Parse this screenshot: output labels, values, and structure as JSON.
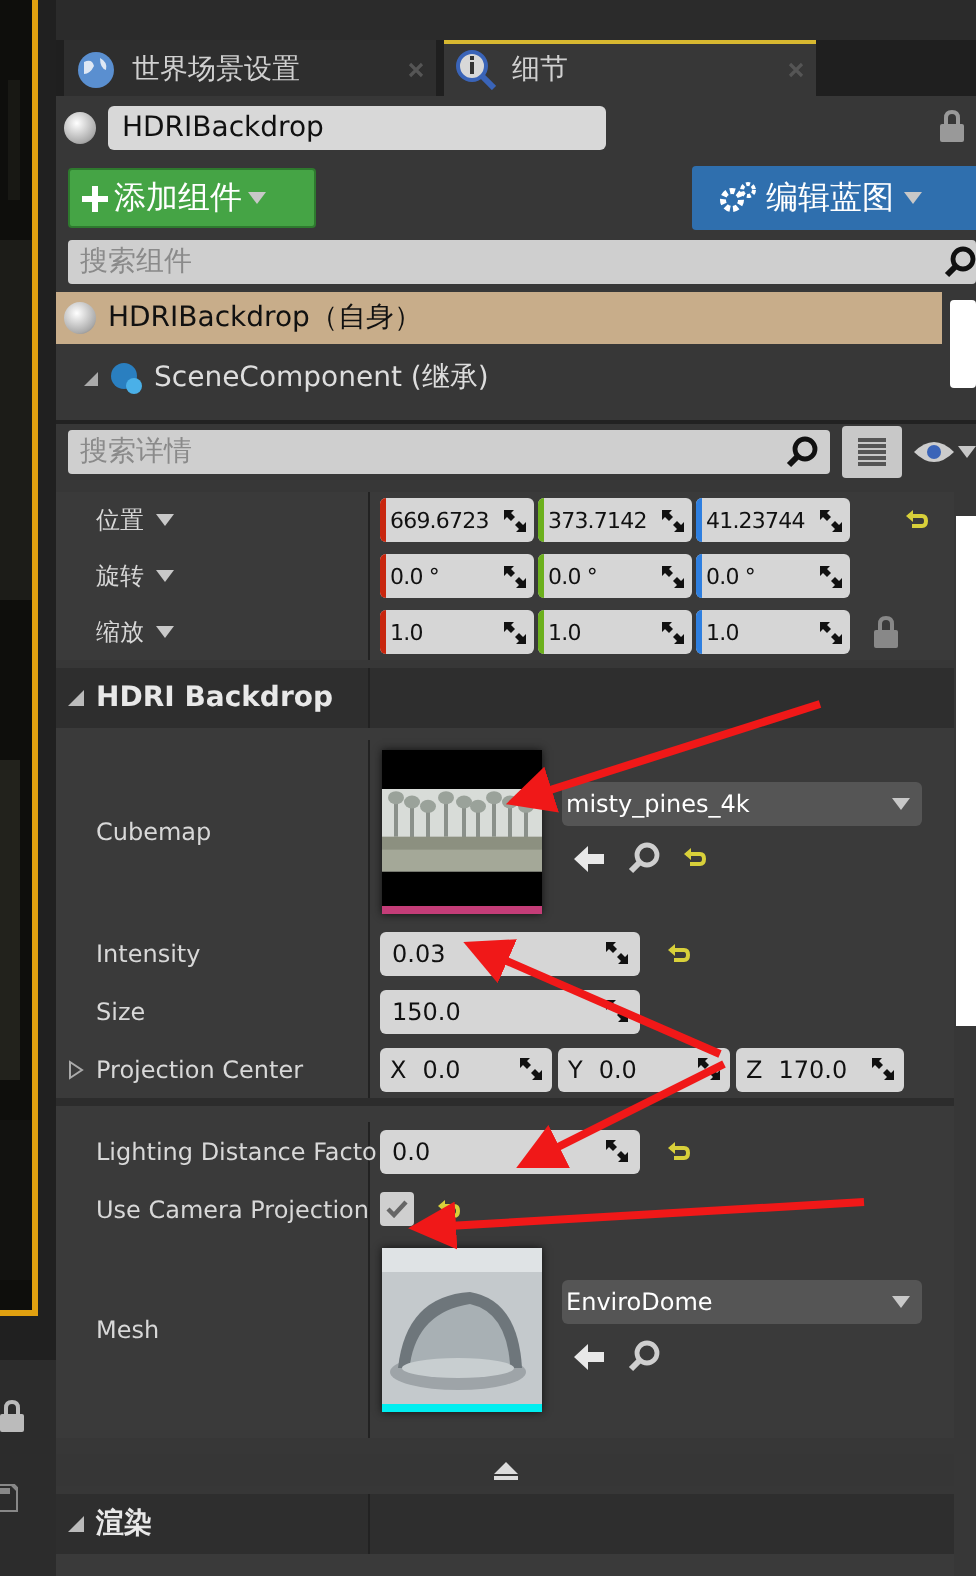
{
  "tabs": [
    {
      "label": "世界场景设置",
      "selected": false
    },
    {
      "label": "细节",
      "selected": true
    }
  ],
  "actor": {
    "name": "HDRIBackdrop"
  },
  "toolbar": {
    "add_button": "添加组件",
    "blueprint_button": "编辑蓝图"
  },
  "component_search": {
    "placeholder": "搜索组件"
  },
  "components": [
    {
      "label": "HDRIBackdrop（自身）",
      "selected": true,
      "children": [
        {
          "label": "SceneComponent (继承)",
          "selected": false,
          "expanded": true
        }
      ]
    }
  ],
  "details_search": {
    "placeholder": "搜索详情"
  },
  "transform": [
    {
      "label": "位置",
      "modified": true,
      "locked": false,
      "values": [
        {
          "value": "669.6723",
          "color": "#c8260e"
        },
        {
          "value": "373.7142",
          "color": "#6cb01c"
        },
        {
          "value": "41.23744",
          "color": "#2e7fe0"
        }
      ]
    },
    {
      "label": "旋转",
      "modified": false,
      "values": [
        {
          "value": "0.0 °",
          "color": "#c8260e"
        },
        {
          "value": "0.0 °",
          "color": "#6cb01c"
        },
        {
          "value": "0.0 °",
          "color": "#2e7fe0"
        }
      ]
    },
    {
      "label": "缩放",
      "modified": false,
      "locked": true,
      "values": [
        {
          "value": "1.0",
          "color": "#c8260e"
        },
        {
          "value": "1.0",
          "color": "#6cb01c"
        },
        {
          "value": "1.0",
          "color": "#2e7fe0"
        }
      ]
    }
  ],
  "sections": [
    {
      "title": "HDRI Backdrop",
      "expanded": true,
      "properties": [
        {
          "kind": "asset",
          "label": "Cubemap",
          "value": "misty_pines_4k",
          "color": "#c43d78",
          "modified": true
        },
        {
          "kind": "number",
          "label": "Intensity",
          "value": "0.03",
          "modified": true
        },
        {
          "kind": "number",
          "label": "Size",
          "value": "150.0",
          "modified": false
        },
        {
          "kind": "vector",
          "label": "Projection Center",
          "expanded": false,
          "modified": false,
          "values": [
            {
              "axis": "X",
              "value": "0.0"
            },
            {
              "axis": "Y",
              "value": "0.0"
            },
            {
              "axis": "Z",
              "value": "170.0"
            }
          ]
        },
        {
          "kind": "number",
          "label": "Lighting Distance Facto",
          "value": "0.0",
          "modified": true,
          "divider": true
        },
        {
          "kind": "checkbox",
          "label": "Use Camera Projection",
          "checked": true,
          "modified": true
        },
        {
          "kind": "asset",
          "label": "Mesh",
          "value": "EnviroDome",
          "color": "#00eef0",
          "modified": false
        }
      ]
    },
    {
      "title": "渲染",
      "expanded": true
    }
  ]
}
